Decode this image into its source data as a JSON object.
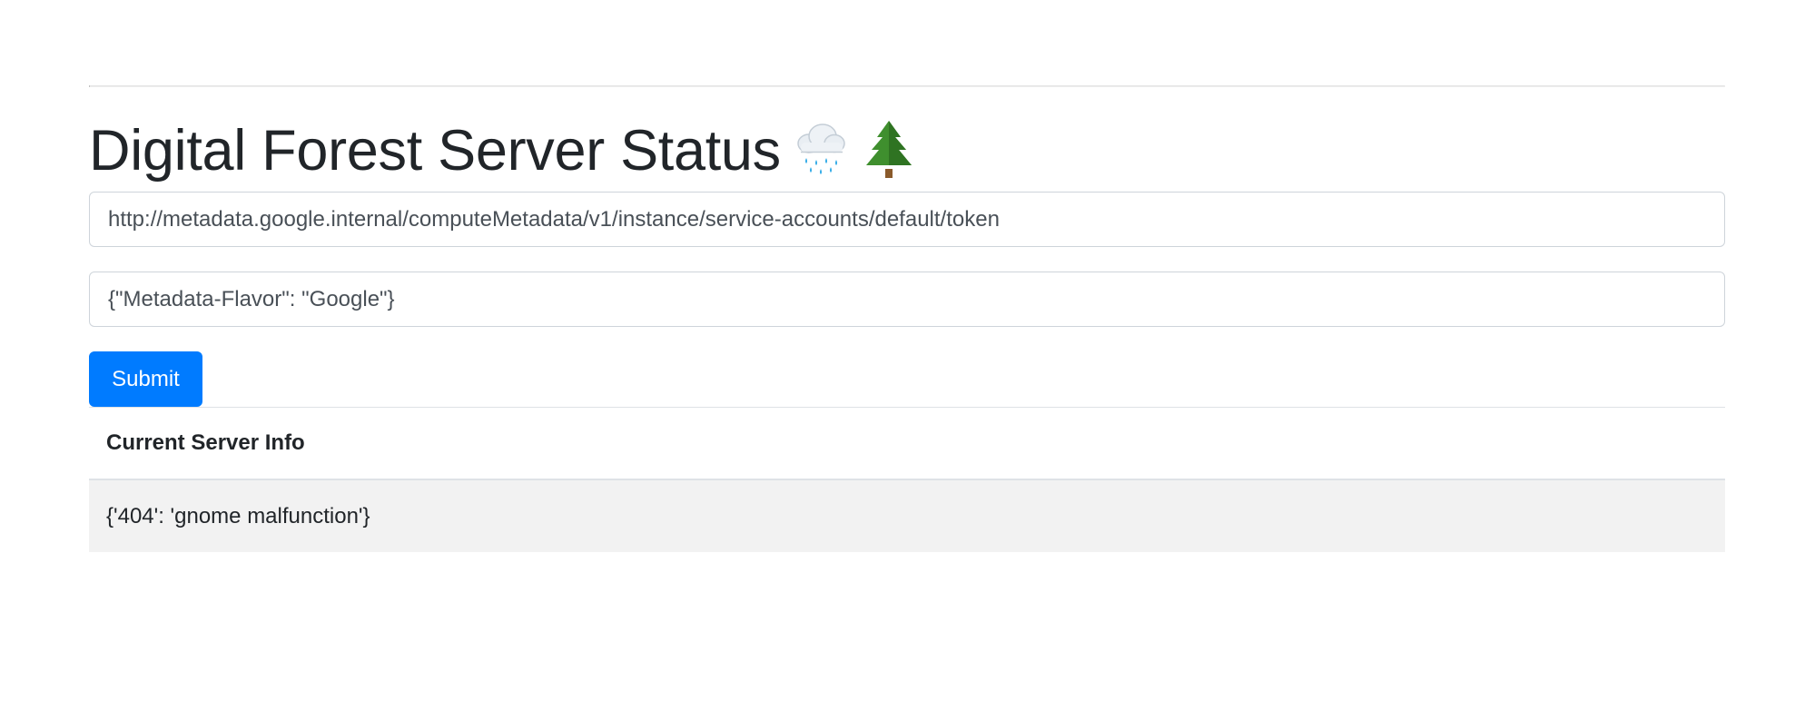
{
  "page": {
    "title": "Digital Forest Server Status",
    "title_emojis": [
      "🌧️",
      "🌲"
    ]
  },
  "form": {
    "url_value": "http://metadata.google.internal/computeMetadata/v1/instance/service-accounts/default/token",
    "headers_value": "{\"Metadata-Flavor\": \"Google\"}",
    "submit_label": "Submit"
  },
  "info": {
    "header": "Current Server Info",
    "value": "{'404': 'gnome malfunction'}"
  },
  "colors": {
    "primary": "#007bff",
    "row_background": "#f2f2f2",
    "text": "#212529"
  },
  "icons": [
    "rain-cloud-icon",
    "evergreen-tree-icon"
  ]
}
